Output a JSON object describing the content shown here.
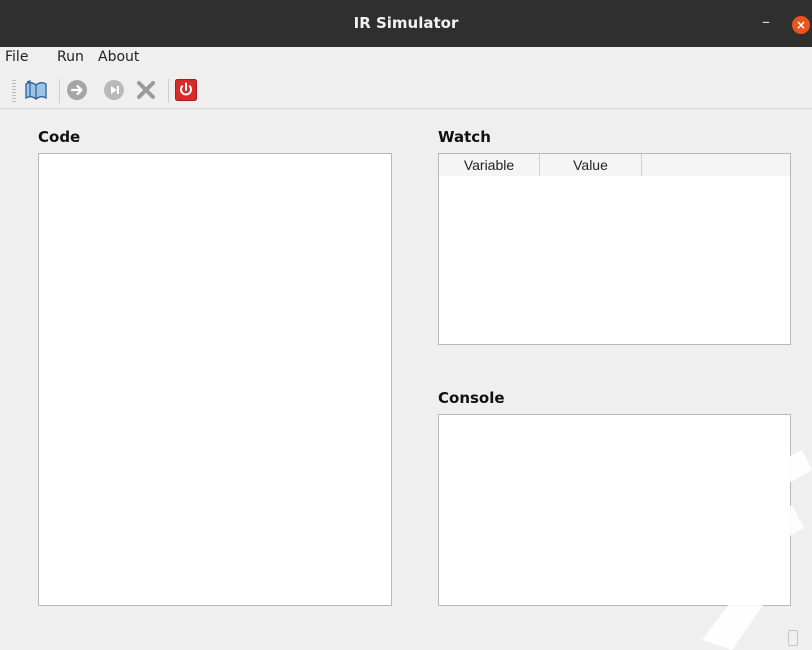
{
  "window": {
    "title": "IR Simulator"
  },
  "menu": {
    "items": [
      "File",
      "Run",
      "About"
    ]
  },
  "toolbar": {
    "icons": [
      "open-file-icon",
      "step-forward-icon",
      "step-icon",
      "stop-icon",
      "power-icon"
    ]
  },
  "code": {
    "label": "Code",
    "content": ""
  },
  "watch": {
    "label": "Watch",
    "columns": [
      "Variable",
      "Value"
    ],
    "rows": []
  },
  "console": {
    "label": "Console",
    "content": ""
  },
  "colors": {
    "titlebar": "#2f2f2f",
    "close_button": "#e95420",
    "power": "#d72b2b",
    "background": "#efefef"
  }
}
